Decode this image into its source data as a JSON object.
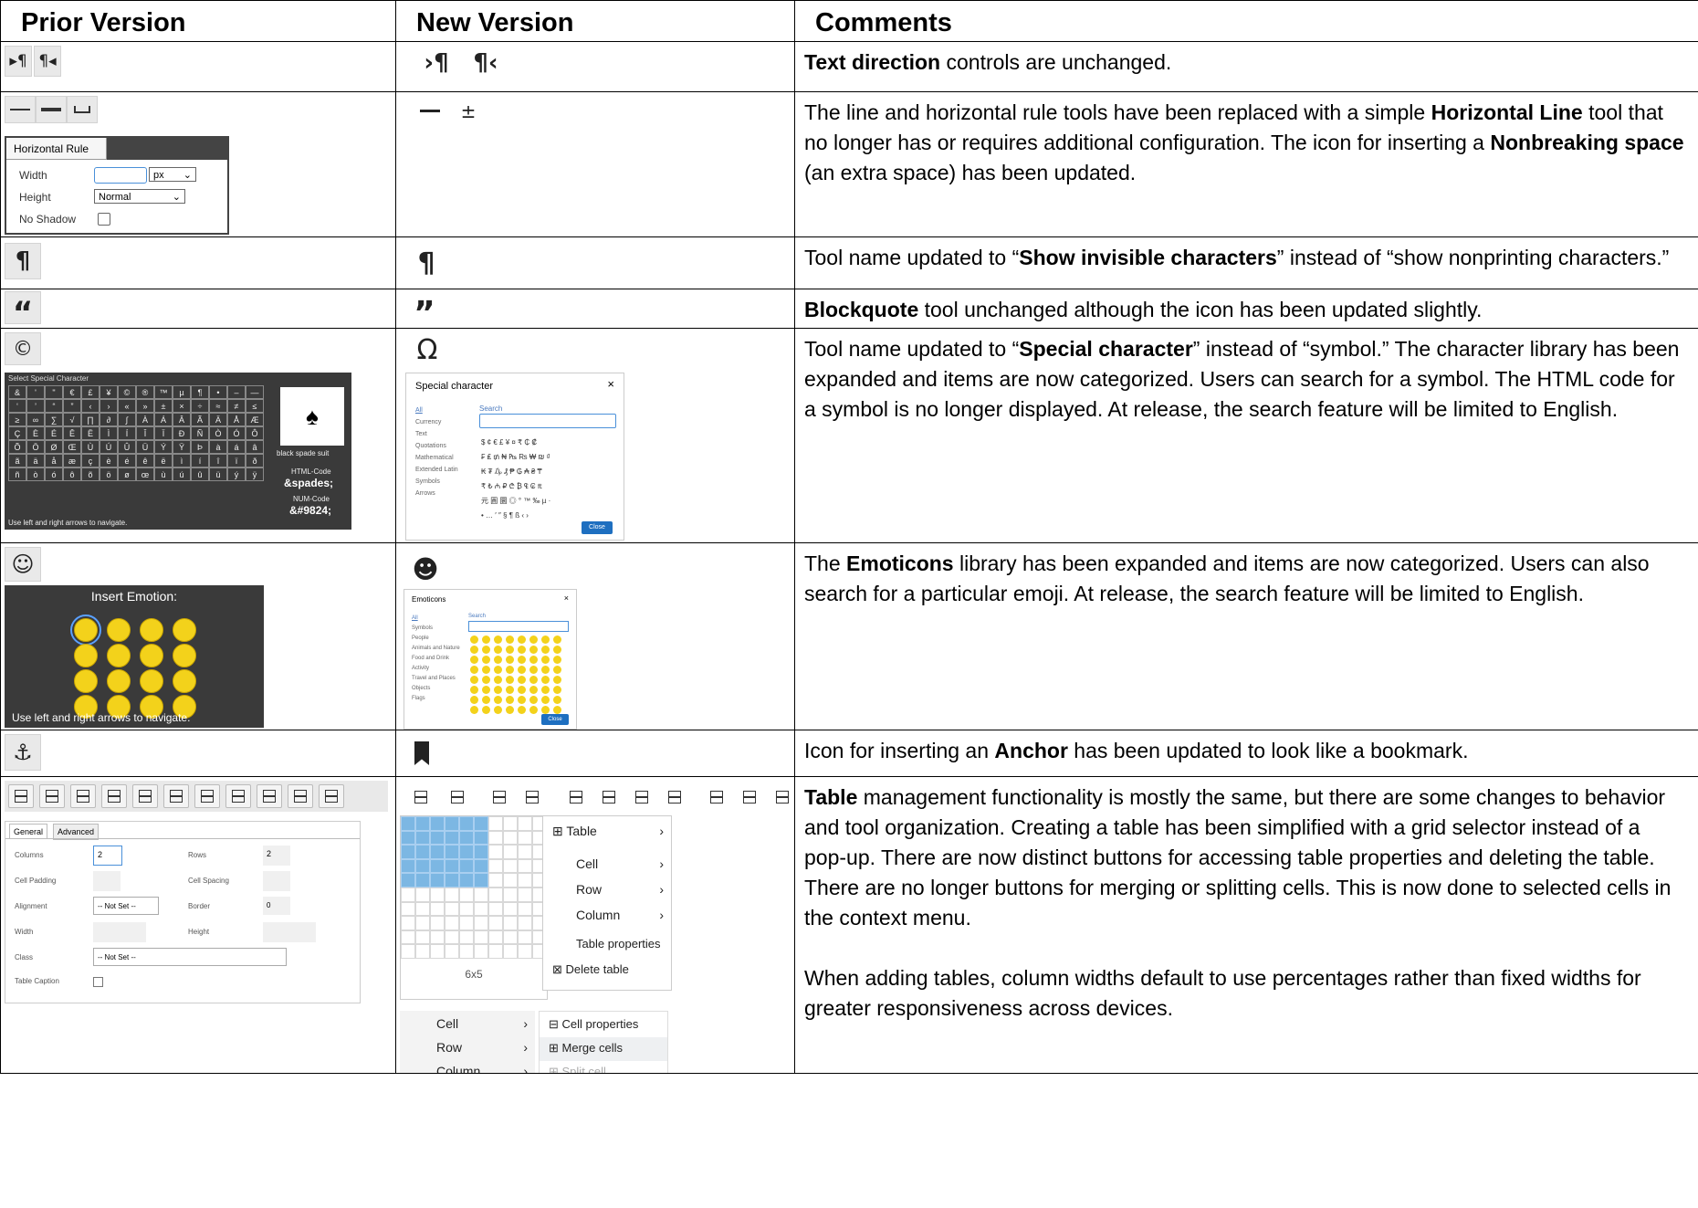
{
  "headers": {
    "prior": "Prior Version",
    "new": "New Version",
    "comments": "Comments"
  },
  "rows": {
    "direction": {
      "prior_icons": [
        "▸¶",
        "¶◂"
      ],
      "new_icons": [
        "›¶",
        "¶‹"
      ],
      "comment": [
        {
          "b": "Text direction"
        },
        {
          "t": " controls are unchanged."
        }
      ]
    },
    "hrule": {
      "prior_panel_title": "Horizontal Rule",
      "width_label": "Width",
      "width_unit": "px",
      "height_label": "Height",
      "height_value": "Normal",
      "noshadow_label": "No Shadow",
      "comment": [
        {
          "t": "The line and horizontal rule tools have been replaced with a simple "
        },
        {
          "b": "Horizontal Line"
        },
        {
          "t": " tool that no longer has or requires additional configuration. The icon for inserting a "
        },
        {
          "b": "Nonbreaking space"
        },
        {
          "t": " (an extra space) has been updated."
        }
      ]
    },
    "invisible": {
      "prior_icon": "¶",
      "new_icon": "¶",
      "comment": [
        {
          "t": "Tool name updated to “"
        },
        {
          "b": "Show invisible characters"
        },
        {
          "t": "” instead of “show nonprinting characters.”"
        }
      ]
    },
    "blockquote": {
      "prior_icon": "“",
      "new_icon": "”",
      "comment": [
        {
          "b": "Blockquote"
        },
        {
          "t": " tool unchanged although the icon has been updated slightly."
        }
      ]
    },
    "special": {
      "prior_icon": "©",
      "prior_dialog_title": "Select Special Character",
      "prior_symbol_name": "black spade suit",
      "prior_html_code_label": "HTML-Code",
      "prior_html_code": "&spades;",
      "prior_num_code_label": "NUM-Code",
      "prior_num_code": "&#9824;",
      "prior_nav_hint": "Use left and right arrows to navigate.",
      "new_icon": "Ω",
      "new_dialog_title": "Special character",
      "new_categories": [
        "All",
        "Currency",
        "Text",
        "Quotations",
        "Mathematical",
        "Extended Latin",
        "Symbols",
        "Arrows"
      ],
      "new_search_label": "Search",
      "new_close": "Close",
      "comment": [
        {
          "t": "Tool name updated to “"
        },
        {
          "b": "Special character"
        },
        {
          "t": "” instead of “symbol.” The character library has been expanded and items are now categorized. Users can search for a symbol. The HTML code for a symbol is no longer displayed. At release, the search feature will be limited to English."
        }
      ]
    },
    "emoticons": {
      "prior_title": "Insert Emotion:",
      "prior_nav_hint": "Use left and right arrows to navigate.",
      "new_dialog_title": "Emoticons",
      "new_categories": [
        "All",
        "Symbols",
        "People",
        "Animals and Nature",
        "Food and Drink",
        "Activity",
        "Travel and Places",
        "Objects",
        "Flags"
      ],
      "new_search_label": "Search",
      "new_close": "Close",
      "comment": [
        {
          "t": "The "
        },
        {
          "b": "Emoticons"
        },
        {
          "t": " library has been expanded and items are now categorized. Users can also search for a particular emoji. At release, the search feature will be limited to English."
        }
      ]
    },
    "anchor": {
      "prior_icon": "⚓",
      "comment": [
        {
          "t": "Icon for inserting an "
        },
        {
          "b": "Anchor"
        },
        {
          "t": " has been updated to look like a bookmark."
        }
      ]
    },
    "table": {
      "tabs": [
        "General",
        "Advanced"
      ],
      "fields": {
        "columns_label": "Columns",
        "columns_value": "2",
        "rows_label": "Rows",
        "rows_value": "2",
        "padding_label": "Cell Padding",
        "spacing_label": "Cell Spacing",
        "alignment_label": "Alignment",
        "alignment_value": "-- Not Set --",
        "border_label": "Border",
        "border_value": "0",
        "width_label": "Width",
        "height_label": "Height",
        "class_label": "Class",
        "class_value": "-- Not Set --",
        "caption_label": "Table Caption"
      },
      "grid_size": "6x5",
      "grid_selected": {
        "cols": 6,
        "rows": 5
      },
      "menu": [
        "Table",
        "Cell",
        "Row",
        "Column",
        "Table properties",
        "Delete table"
      ],
      "submenu": [
        "Cell",
        "Row",
        "Column"
      ],
      "cell_menu": [
        "Cell properties",
        "Merge cells",
        "Split cell"
      ],
      "comment_p1": [
        {
          "b": "Table"
        },
        {
          "t": " management functionality is mostly the same, but there are some changes to behavior and tool organization. Creating a table has been simplified with a grid selector instead of a pop-up. There are now distinct buttons for accessing table properties and deleting the table. There are no longer buttons for merging or splitting cells. This is now done to selected cells in the context menu."
        }
      ],
      "comment_p2": [
        {
          "t": "When adding tables, column widths default to use percentages rather than fixed widths for greater responsiveness across devices."
        }
      ]
    }
  }
}
